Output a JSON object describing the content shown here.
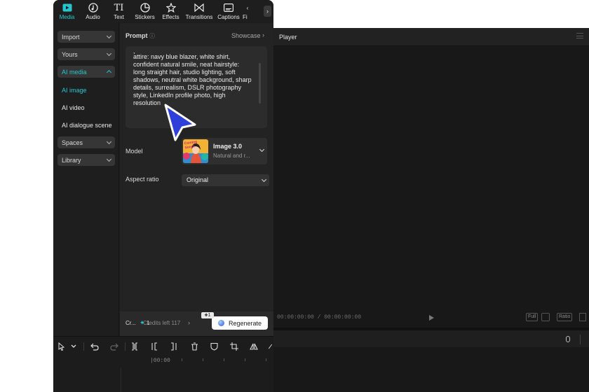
{
  "toolbar": {
    "tabs": [
      {
        "label": "Media",
        "icon": "media-icon",
        "active": true
      },
      {
        "label": "Audio",
        "icon": "audio-icon"
      },
      {
        "label": "Text",
        "icon": "text-icon"
      },
      {
        "label": "Stickers",
        "icon": "stickers-icon"
      },
      {
        "label": "Effects",
        "icon": "effects-icon"
      },
      {
        "label": "Transitions",
        "icon": "transitions-icon"
      },
      {
        "label": "Captions",
        "icon": "captions-icon"
      },
      {
        "label": "Fi",
        "icon": "filters-icon"
      }
    ],
    "more": "›"
  },
  "sidebar": {
    "import": "Import",
    "yours": "Yours",
    "ai_media": "AI media",
    "ai_image": "AI image",
    "ai_video": "AI video",
    "ai_dialogue": "AI dialogue scene",
    "spaces": "Spaces",
    "library": "Library"
  },
  "panel": {
    "prompt_label": "Prompt",
    "info_icon": "ⓘ",
    "showcase": "Showcase",
    "prompt_lines": [
      ",",
      "attire: navy blue blazer, white shirt,",
      "confident natural smile, neat hairstyle:",
      "long straight hair, studio lighting, soft",
      "shadows, neutral white background, sharp",
      "details, surrealism, DSLR photography",
      "style, LinkedIn profile photo, high",
      "resolution"
    ],
    "model_label": "Model",
    "model_name": "Image 3.0",
    "model_desc": "Natural and r...",
    "thumb_text": "Coming Soon!",
    "aspect_label": "Aspect ratio",
    "aspect_value": "Original"
  },
  "footer": {
    "cr": "Cr...",
    "credit_count": "1",
    "credits_left": "Credits left  117",
    "regenerate": "Regenerate",
    "badge": "1"
  },
  "timeline": {
    "time": "|00:00"
  },
  "player": {
    "title": "Player",
    "timecode": "00:00:00:00 / 00:00:00:00",
    "full": "Full",
    "ratio": "Ratio"
  },
  "colors": {
    "accent": "#25c7cf",
    "cursor": "#2f3fd9"
  }
}
